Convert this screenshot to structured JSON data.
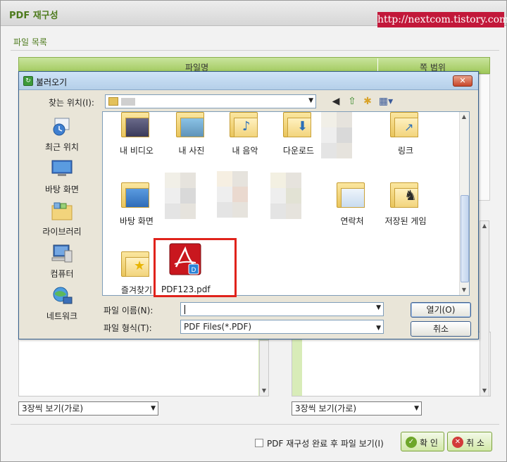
{
  "watermark": "http://nextcom.tistory.com",
  "outer": {
    "title": "PDF 재구성",
    "file_list_label": "파일 목록",
    "columns": [
      "파일명",
      "쪽 범위"
    ],
    "view_select_left": "3장씩 보기(가로)",
    "view_select_right": "3장씩 보기(가로)",
    "view_after_label": "PDF 재구성 완료 후 파일 보기(I)",
    "ok_label": "확 인",
    "cancel_label": "취 소"
  },
  "open_dialog": {
    "title": "불러오기",
    "close_label": "✕",
    "look_in_label": "찾는 위치(I):",
    "places": [
      {
        "label": "최근 위치",
        "icon": "recent-places-icon"
      },
      {
        "label": "바탕 화면",
        "icon": "desktop-icon"
      },
      {
        "label": "라이브러리",
        "icon": "libraries-icon"
      },
      {
        "label": "컴퓨터",
        "icon": "computer-icon"
      },
      {
        "label": "네트워크",
        "icon": "network-icon"
      }
    ],
    "files": [
      {
        "label": "내 비디오",
        "icon": "my-videos-folder-icon"
      },
      {
        "label": "내 사진",
        "icon": "my-pictures-folder-icon"
      },
      {
        "label": "내 음악",
        "icon": "my-music-folder-icon"
      },
      {
        "label": "다운로드",
        "icon": "downloads-folder-icon"
      },
      {
        "label": "링크",
        "icon": "links-folder-icon"
      },
      {
        "label": "바탕 화면",
        "icon": "desktop-folder-icon"
      },
      {
        "label": "연락처",
        "icon": "contacts-folder-icon"
      },
      {
        "label": "저장된 게임",
        "icon": "saved-games-folder-icon"
      },
      {
        "label": "즐겨찾기",
        "icon": "favorites-folder-icon"
      },
      {
        "label": "PDF123.pdf",
        "icon": "pdf-file-icon"
      }
    ],
    "file_name_label": "파일 이름(N):",
    "file_name_value": "",
    "file_type_label": "파일 형식(T):",
    "file_type_value": "PDF Files(*.PDF)",
    "open_button": "열기(O)",
    "cancel_button": "취소"
  },
  "colors": {
    "accent_green": "#9fc85a",
    "highlight_red": "#e0231c",
    "watermark_bg": "#c2183a"
  }
}
